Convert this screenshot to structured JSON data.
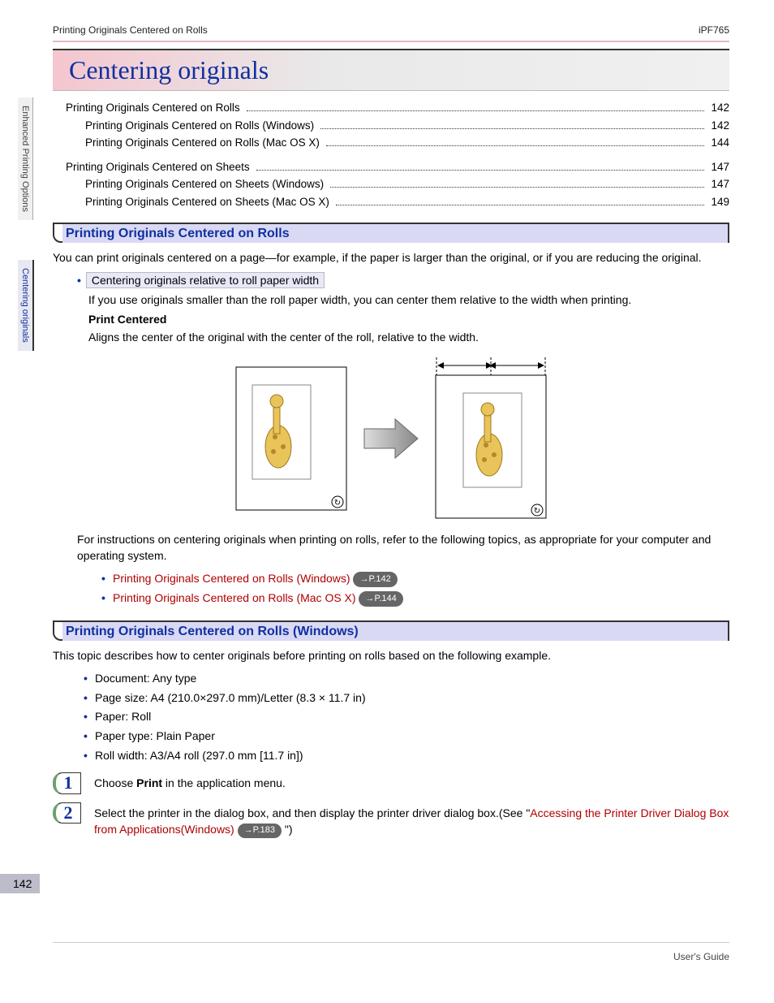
{
  "header": {
    "left": "Printing Originals Centered on Rolls",
    "right": "iPF765"
  },
  "chapter": {
    "title": "Centering originals"
  },
  "toc": {
    "group1": {
      "parent": {
        "label": "Printing Originals Centered on Rolls",
        "page": "142"
      },
      "child1": {
        "label": "Printing Originals Centered on Rolls (Windows)",
        "page": "142"
      },
      "child2": {
        "label": "Printing Originals Centered on Rolls (Mac OS X)",
        "page": "144"
      }
    },
    "group2": {
      "parent": {
        "label": "Printing Originals Centered on Sheets",
        "page": "147"
      },
      "child1": {
        "label": "Printing Originals Centered on Sheets (Windows)",
        "page": "147"
      },
      "child2": {
        "label": "Printing Originals Centered on Sheets (Mac OS X)",
        "page": "149"
      }
    }
  },
  "section1": {
    "title": "Printing Originals Centered on Rolls",
    "intro": "You can print originals centered on a page—for example, if the paper is larger than the original, or if you are reducing the original.",
    "bullet_hl": "Centering originals relative to roll paper width",
    "bullet_text": "If you use originals smaller than the roll paper width, you can center them relative to the width when printing.",
    "sub_bold": "Print Centered",
    "sub_desc": "Aligns the center of the original with the center of the roll, relative to the width.",
    "instr": "For instructions on centering originals when printing on rolls, refer to the following topics, as appropriate for your computer and operating system.",
    "link1": "Printing Originals Centered on Rolls (Windows)",
    "link1_ref": "→P.142",
    "link2": "Printing Originals Centered on Rolls (Mac OS X)",
    "link2_ref": "→P.144"
  },
  "section2": {
    "title": "Printing Originals Centered on Rolls (Windows)",
    "intro": "This topic describes how to center originals before printing on rolls based on the following example.",
    "b1": "Document: Any type",
    "b2": "Page size: A4 (210.0×297.0 mm)/Letter (8.3 × 11.7 in)",
    "b3": "Paper: Roll",
    "b4": "Paper type: Plain Paper",
    "b5": "Roll width: A3/A4 roll (297.0 mm [11.7 in])",
    "step1_num": "1",
    "step1_a": "Choose ",
    "step1_bold": "Print",
    "step1_b": " in the application menu.",
    "step2_num": "2",
    "step2_a": "Select the printer in the dialog box, and then display the printer driver dialog box.(See \"",
    "step2_link": "Accessing the Printer Driver Dialog Box from Applications(Windows)",
    "step2_ref": "→P.183",
    "step2_b": " \")"
  },
  "side": {
    "tab1": "Enhanced Printing Options",
    "tab2": "Centering originals"
  },
  "page_number": "142",
  "footer": "User's Guide"
}
